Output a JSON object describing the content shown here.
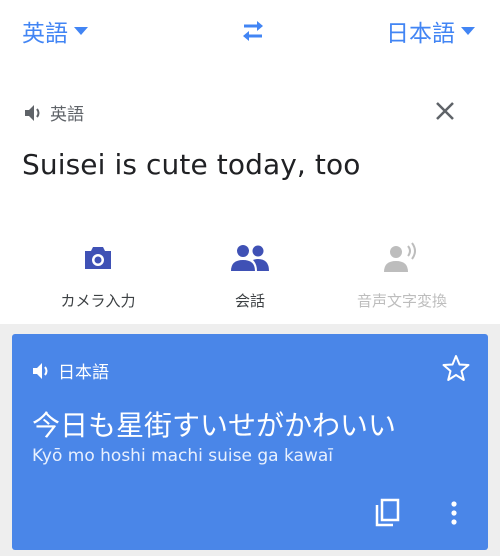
{
  "header": {
    "source_language": "英語",
    "target_language": "日本語"
  },
  "input": {
    "language_label": "英語",
    "text": "Suisei is cute today, too"
  },
  "tools": [
    {
      "label": "カメラ入力",
      "icon": "camera-icon"
    },
    {
      "label": "会話",
      "icon": "conversation-icon"
    },
    {
      "label": "音声文字変換",
      "icon": "transcribe-icon"
    }
  ],
  "result": {
    "language_label": "日本語",
    "text": "今日も星街すいせがかわいい",
    "transliteration": "Kyō mo hoshi machi suise ga kawaī"
  },
  "colors": {
    "accent": "#4285f4",
    "result_card": "#4a86e8",
    "tool_icon": "#3f51b5",
    "disabled": "#bdbdbd"
  }
}
